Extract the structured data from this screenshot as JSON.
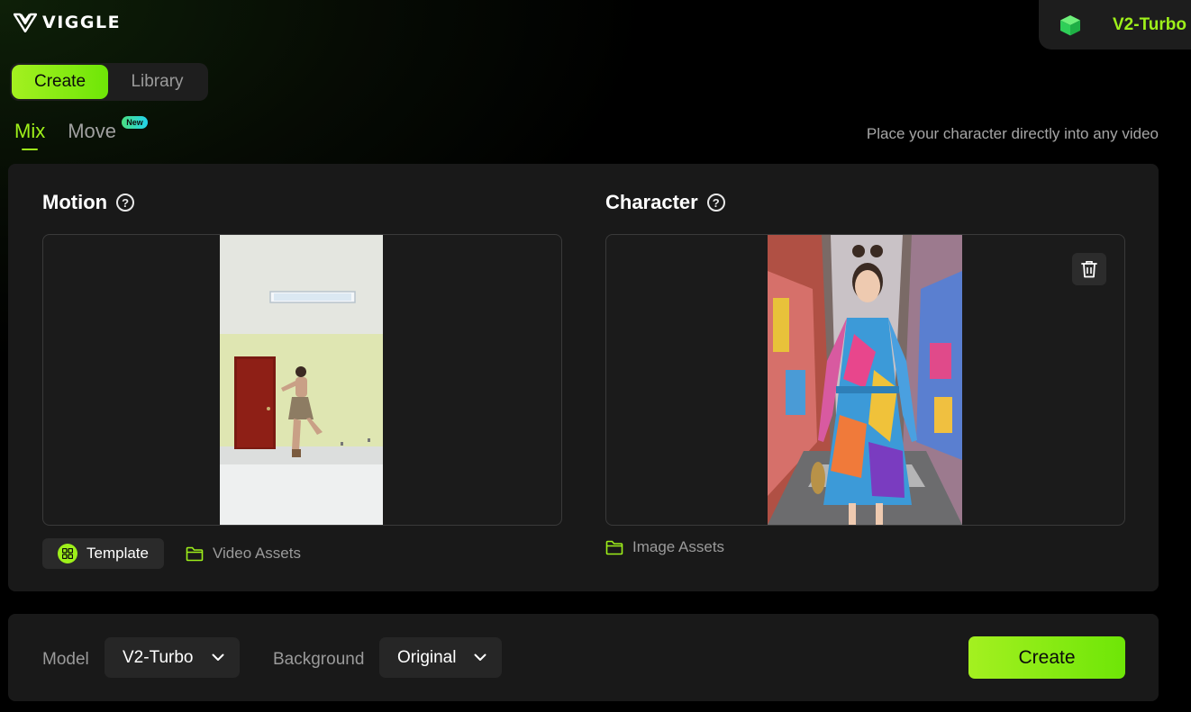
{
  "brand": {
    "name": "VIGGLE"
  },
  "plan": {
    "label": "V2-Turbo",
    "icon": "cube-icon"
  },
  "main_tabs": [
    {
      "label": "Create",
      "active": true
    },
    {
      "label": "Library",
      "active": false
    }
  ],
  "sub_tabs": [
    {
      "label": "Mix",
      "active": true
    },
    {
      "label": "Move",
      "active": false,
      "badge": "New"
    }
  ],
  "tagline": "Place your character directly into any video",
  "motion": {
    "title": "Motion",
    "help_icon": "help-circle-icon",
    "template_label": "Template",
    "assets_label": "Video Assets"
  },
  "character": {
    "title": "Character",
    "help_icon": "help-circle-icon",
    "delete_icon": "trash-icon",
    "assets_label": "Image Assets"
  },
  "settings": {
    "model_label": "Model",
    "model_value": "V2-Turbo",
    "background_label": "Background",
    "background_value": "Original",
    "create_label": "Create"
  },
  "colors": {
    "accent": "#9ef01a",
    "panel": "#191919",
    "muted_text": "#9a9a9a"
  }
}
